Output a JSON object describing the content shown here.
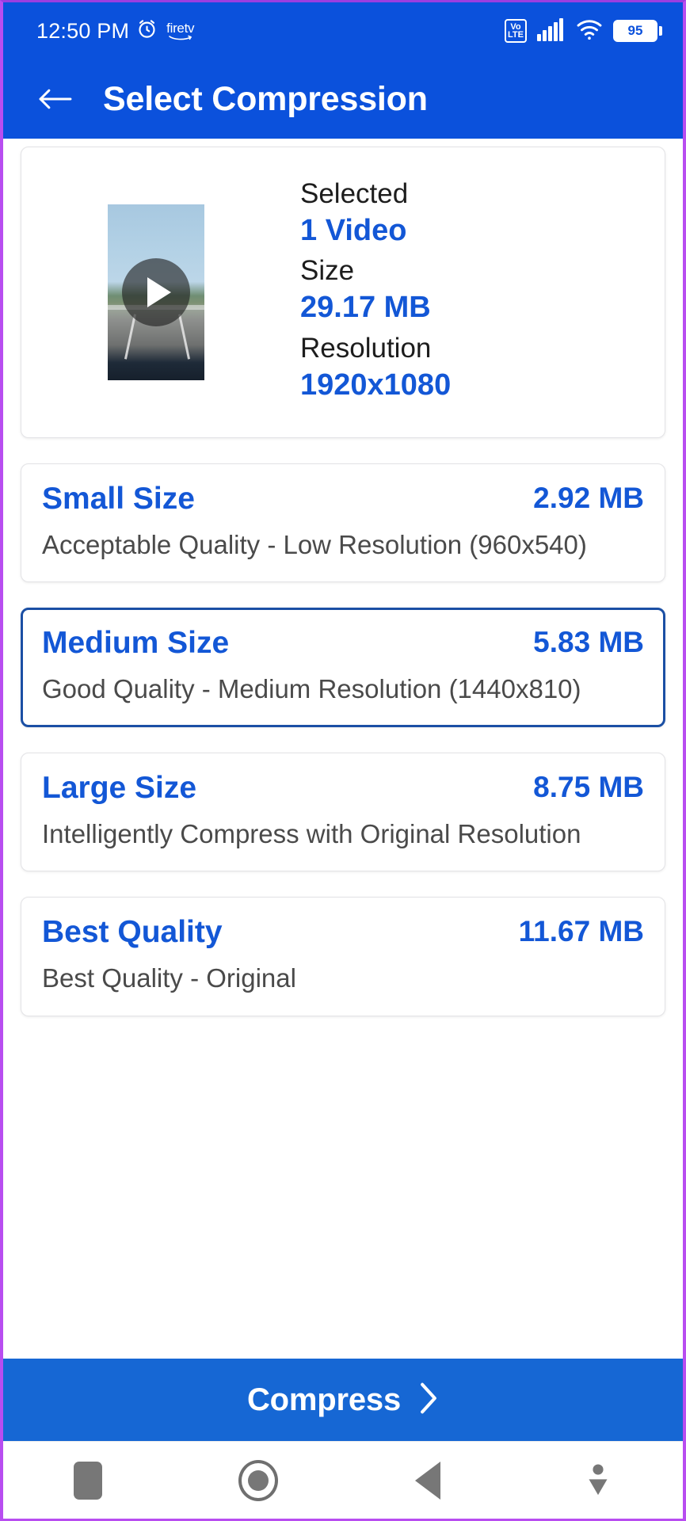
{
  "statusbar": {
    "time": "12:50 PM",
    "alarm_icon": "alarm-clock-icon",
    "brand_logo": "firetv-logo",
    "brand_word_top": "fire",
    "brand_word_bottom": "tv",
    "volte_top": "Vo",
    "volte_bottom": "LTE",
    "signal_icon": "cellular-signal-icon",
    "wifi_icon": "wifi-icon",
    "battery_level": "95"
  },
  "appbar": {
    "back_icon": "back-arrow-icon",
    "title": "Select Compression"
  },
  "info_card": {
    "thumbnail_name": "video-thumbnail",
    "play_icon": "play-icon",
    "rows": [
      {
        "label": "Selected",
        "value": "1 Video"
      },
      {
        "label": "Size",
        "value": "29.17 MB"
      },
      {
        "label": "Resolution",
        "value": "1920x1080"
      }
    ]
  },
  "options": [
    {
      "title": "Small Size",
      "size": "2.92 MB",
      "description": "Acceptable Quality - Low Resolution (960x540)",
      "selected": false
    },
    {
      "title": "Medium Size",
      "size": "5.83 MB",
      "description": "Good Quality - Medium Resolution (1440x810)",
      "selected": true
    },
    {
      "title": "Large Size",
      "size": "8.75 MB",
      "description": "Intelligently Compress with Original Resolution",
      "selected": false
    },
    {
      "title": "Best Quality",
      "size": "11.67 MB",
      "description": "Best Quality - Original",
      "selected": false
    }
  ],
  "compress_button": {
    "label": "Compress",
    "chevron_icon": "chevron-right-icon"
  },
  "navbar": {
    "recents_icon": "recents-square-icon",
    "home_icon": "home-circle-icon",
    "back_icon": "back-triangle-icon",
    "hide_keyboard_icon": "hide-keyboard-icon"
  },
  "colors": {
    "primary_blue": "#0b51dc",
    "accent_blue": "#1357d6",
    "button_blue": "#1667d4",
    "selected_border": "#1b4fa4",
    "text_dark": "#1d1d1d",
    "text_muted": "#4a4a4a"
  }
}
